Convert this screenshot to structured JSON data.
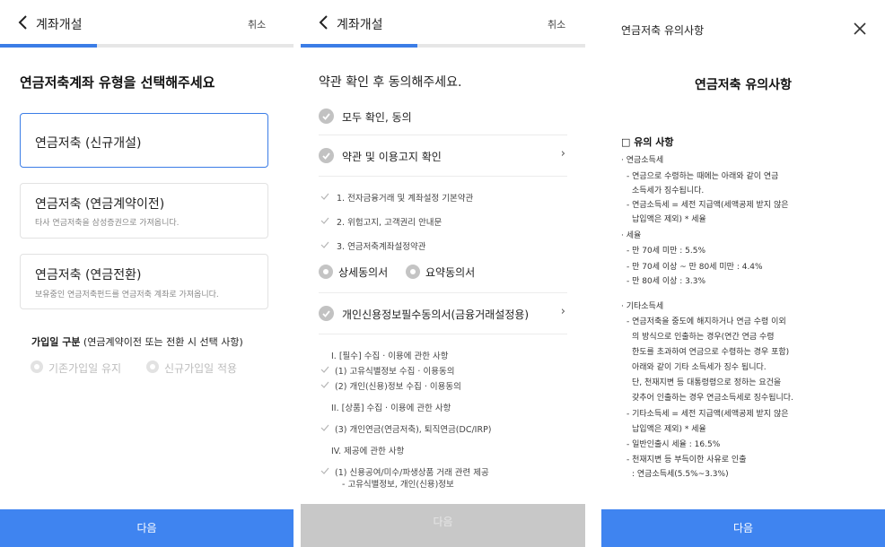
{
  "panel1": {
    "header_title": "계좌개설",
    "cancel_label": "취소",
    "progress_percent": 33,
    "page_title": "연금저축계좌 유형을 선택해주세요",
    "options": [
      {
        "title": "연금저축 (신규개설)",
        "subtitle": "",
        "selected": true
      },
      {
        "title": "연금저축 (연금계약이전)",
        "subtitle": "타사 연금저축을 삼성증권으로 가져옵니다.",
        "selected": false
      },
      {
        "title": "연금저축 (연금전환)",
        "subtitle": "보유중인 연금저축펀드를 연금저축 계좌로 가져옵니다.",
        "selected": false
      }
    ],
    "join_label_bold": "가입일 구분",
    "join_label_rest": " (연금계약이전 또는 전환 시 선택 사항)",
    "join_options": [
      "기존가입일 유지",
      "신규가입일 적용"
    ],
    "next_label": "다음"
  },
  "panel2": {
    "header_title": "계좌개설",
    "cancel_label": "취소",
    "progress_percent": 41,
    "page_title": "약관 확인 후 동의해주세요.",
    "agree_all": "모두 확인, 동의",
    "terms_header": "약관 및 이용고지 확인",
    "terms_items": [
      "1. 전자금융거래 및 계좌설정 기본약관",
      "2. 위험고지, 고객권리 안내문",
      "3. 연금저축계좌설정약관"
    ],
    "consent_types": [
      "상세동의서",
      "요약동의서"
    ],
    "credit_header": "개인신용정보필수동의서(금융거래설정용)",
    "credit_sections": [
      {
        "type": "heading",
        "text": "I. [필수] 수집 · 이용에 관한 사항"
      },
      {
        "type": "item",
        "text": "(1) 고유식별정보 수집 · 이용동의"
      },
      {
        "type": "item",
        "text": "(2) 개인(신용)정보 수집 · 이용동의"
      },
      {
        "type": "heading",
        "text": "II. [상품] 수집 · 이용에 관한 사항"
      },
      {
        "type": "item",
        "text": "(3) 개인연금(연금저축), 퇴직연금(DC/IRP)"
      },
      {
        "type": "heading",
        "text": "IV. 제공에 관한 사항"
      },
      {
        "type": "item",
        "text": "(1) 신용공여/미수/파생상품 거래 관련 제공"
      },
      {
        "type": "cont",
        "text": "- 고유식별정보, 개인(신용)정보"
      }
    ],
    "next_label": "다음",
    "chevron": "›"
  },
  "panel3": {
    "header_title": "연금저축 유의사항",
    "title": "연금저축 유의사항",
    "section_title": "□ 유의 사항",
    "lines": [
      "· 연금소득세",
      "- 연금으로 수령하는 때에는 아래와 같이 연금",
      "소득세가 징수됩니다.",
      "- 연금소득세 = 세전 지급액(세액공제 받지 않은",
      "납입액은 제외) * 세율",
      "· 세율",
      "- 만 70세 미만 : 5.5%",
      "- 만 70세 이상 ~ 만 80세 미만 :  4.4%",
      "- 만 80세 이상 : 3.3%",
      "· 기타소득세",
      "- 연금저축을 중도에 해지하거나 연금 수령 이외",
      "의 방식으로 인출하는 경우(연간 연금 수령",
      "한도를 초과하여 연금으로 수령하는 경우 포함)",
      "아래와 같이 기타 소득세가 징수 됩니다.",
      "단, 천재지변 등 대통령령으로 정하는 요건을",
      "갖추어 인출하는 경우 연금소득세로 징수됩니다.",
      "- 기타소득세 = 세전 지급액(세액공제 받지 않은",
      "납입액은 제외) * 세율",
      "- 일반인출시 세율 : 16.5%",
      "- 천재지변 등 부득이한 사유로 인출",
      ": 연금소득세(5.5%~3.3%)"
    ],
    "next_label": "다음"
  },
  "colors": {
    "accent": "#3f84f0",
    "progress": "#3b7de6",
    "disabled": "#c8c8c8",
    "check": "#c2c2c2"
  }
}
